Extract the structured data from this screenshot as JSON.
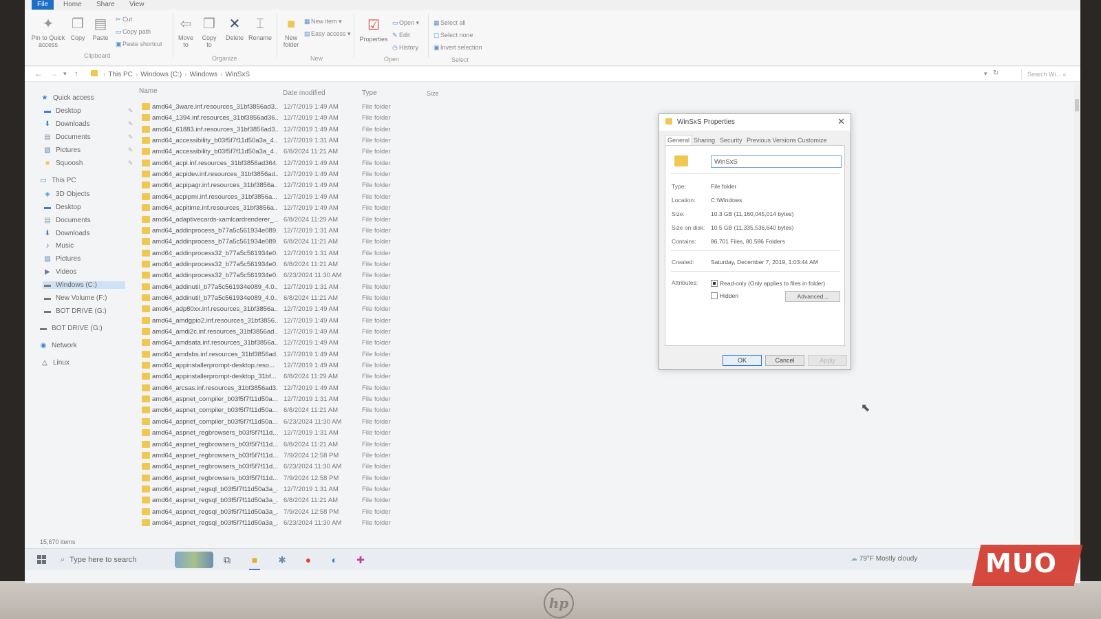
{
  "ribbon": {
    "tabs": [
      "File",
      "Home",
      "Share",
      "View"
    ],
    "clipboard": {
      "pin_label": "Pin to Quick access",
      "copy_label": "Copy",
      "paste_label": "Paste",
      "cut": "Cut",
      "copy_path": "Copy path",
      "paste_shortcut": "Paste shortcut",
      "group": "Clipboard"
    },
    "organize": {
      "move_to": "Move to",
      "copy_to": "Copy to",
      "delete": "Delete",
      "rename": "Rename",
      "group": "Organize"
    },
    "new": {
      "new_folder": "New folder",
      "new_item": "New item",
      "easy_access": "Easy access",
      "group": "New"
    },
    "open": {
      "properties": "Properties",
      "open": "Open",
      "edit": "Edit",
      "history": "History",
      "group": "Open"
    },
    "select": {
      "select_all": "Select all",
      "select_none": "Select none",
      "invert": "Invert selection",
      "group": "Select"
    }
  },
  "address": {
    "crumbs": [
      "This PC",
      "Windows (C:)",
      "Windows",
      "WinSxS"
    ],
    "search_placeholder": "Search Wi..."
  },
  "sidebar": {
    "items": [
      {
        "label": "Quick access",
        "icon": "star-icon",
        "pinned": false
      },
      {
        "label": "Desktop",
        "icon": "desktop-icon",
        "pinned": true
      },
      {
        "label": "Downloads",
        "icon": "download-icon",
        "pinned": true
      },
      {
        "label": "Documents",
        "icon": "document-icon",
        "pinned": true
      },
      {
        "label": "Pictures",
        "icon": "picture-icon",
        "pinned": true
      },
      {
        "label": "Squoosh",
        "icon": "folder-icon",
        "pinned": true
      },
      {
        "label": "This PC",
        "icon": "computer-icon",
        "pinned": false
      },
      {
        "label": "3D Objects",
        "icon": "cube-icon",
        "pinned": false
      },
      {
        "label": "Desktop",
        "icon": "desktop-icon",
        "pinned": false
      },
      {
        "label": "Documents",
        "icon": "document-icon",
        "pinned": false
      },
      {
        "label": "Downloads",
        "icon": "download-icon",
        "pinned": false
      },
      {
        "label": "Music",
        "icon": "music-icon",
        "pinned": false
      },
      {
        "label": "Pictures",
        "icon": "picture-icon",
        "pinned": false
      },
      {
        "label": "Videos",
        "icon": "video-icon",
        "pinned": false
      },
      {
        "label": "Windows (C:)",
        "icon": "drive-icon",
        "pinned": false
      },
      {
        "label": "New Volume (F:)",
        "icon": "drive-icon",
        "pinned": false
      },
      {
        "label": "BOT DRIVE (G:)",
        "icon": "drive-icon",
        "pinned": false
      },
      {
        "label": "BOT DRIVE (G:)",
        "icon": "drive-icon",
        "pinned": false
      },
      {
        "label": "Network",
        "icon": "network-icon",
        "pinned": false
      },
      {
        "label": "Linux",
        "icon": "linux-icon",
        "pinned": false
      }
    ]
  },
  "columns": {
    "name": "Name",
    "date": "Date modified",
    "type": "Type",
    "size": "Size"
  },
  "files": [
    {
      "name": "amd64_3ware.inf.resources_31bf3856ad3...",
      "date": "12/7/2019 1:49 AM",
      "type": "File folder"
    },
    {
      "name": "amd64_1394.inf.resources_31bf3856ad36...",
      "date": "12/7/2019 1:49 AM",
      "type": "File folder"
    },
    {
      "name": "amd64_61883.inf.resources_31bf3856ad3...",
      "date": "12/7/2019 1:49 AM",
      "type": "File folder"
    },
    {
      "name": "amd64_accessibility_b03f5f7f11d50a3a_4...",
      "date": "12/7/2019 1:31 AM",
      "type": "File folder"
    },
    {
      "name": "amd64_accessibility_b03f5f7f11d50a3a_4...",
      "date": "6/8/2024 11:21 AM",
      "type": "File folder"
    },
    {
      "name": "amd64_acpi.inf.resources_31bf3856ad364...",
      "date": "12/7/2019 1:49 AM",
      "type": "File folder"
    },
    {
      "name": "amd64_acpidev.inf.resources_31bf3856ad...",
      "date": "12/7/2019 1:49 AM",
      "type": "File folder"
    },
    {
      "name": "amd64_acpipagr.inf.resources_31bf3856a...",
      "date": "12/7/2019 1:49 AM",
      "type": "File folder"
    },
    {
      "name": "amd64_acpipmi.inf.resources_31bf3856a...",
      "date": "12/7/2019 1:49 AM",
      "type": "File folder"
    },
    {
      "name": "amd64_acpitime.inf.resources_31bf3856a...",
      "date": "12/7/2019 1:49 AM",
      "type": "File folder"
    },
    {
      "name": "amd64_adaptivecards-xamlcardrenderer_...",
      "date": "6/8/2024 11:29 AM",
      "type": "File folder"
    },
    {
      "name": "amd64_addinprocess_b77a5c561934e089...",
      "date": "12/7/2019 1:31 AM",
      "type": "File folder"
    },
    {
      "name": "amd64_addinprocess_b77a5c561934e089...",
      "date": "6/8/2024 11:21 AM",
      "type": "File folder"
    },
    {
      "name": "amd64_addinprocess32_b77a5c561934e0...",
      "date": "12/7/2019 1:31 AM",
      "type": "File folder"
    },
    {
      "name": "amd64_addinprocess32_b77a5c561934e0...",
      "date": "6/8/2024 11:21 AM",
      "type": "File folder"
    },
    {
      "name": "amd64_addinprocess32_b77a5c561934e0...",
      "date": "6/23/2024 11:30 AM",
      "type": "File folder"
    },
    {
      "name": "amd64_addinutil_b77a5c561934e089_4.0....",
      "date": "12/7/2019 1:31 AM",
      "type": "File folder"
    },
    {
      "name": "amd64_addinutil_b77a5c561934e089_4.0....",
      "date": "6/8/2024 11:21 AM",
      "type": "File folder"
    },
    {
      "name": "amd64_adp80xx.inf.resources_31bf3856a...",
      "date": "12/7/2019 1:49 AM",
      "type": "File folder"
    },
    {
      "name": "amd64_amdgpio2.inf.resources_31bf3856...",
      "date": "12/7/2019 1:49 AM",
      "type": "File folder"
    },
    {
      "name": "amd64_amdi2c.inf.resources_31bf3856ad...",
      "date": "12/7/2019 1:49 AM",
      "type": "File folder"
    },
    {
      "name": "amd64_amdsata.inf.resources_31bf3856a...",
      "date": "12/7/2019 1:49 AM",
      "type": "File folder"
    },
    {
      "name": "amd64_amdsbs.inf.resources_31bf3856ad...",
      "date": "12/7/2019 1:49 AM",
      "type": "File folder"
    },
    {
      "name": "amd64_appinstallerprompt-desktop.reso...",
      "date": "12/7/2019 1:49 AM",
      "type": "File folder"
    },
    {
      "name": "amd64_appinstallerprompt-desktop_31bf...",
      "date": "6/8/2024 11:29 AM",
      "type": "File folder"
    },
    {
      "name": "amd64_arcsas.inf.resources_31bf3856ad3...",
      "date": "12/7/2019 1:49 AM",
      "type": "File folder"
    },
    {
      "name": "amd64_aspnet_compiler_b03f5f7f11d50a...",
      "date": "12/7/2019 1:31 AM",
      "type": "File folder"
    },
    {
      "name": "amd64_aspnet_compiler_b03f5f7f11d50a...",
      "date": "6/8/2024 11:21 AM",
      "type": "File folder"
    },
    {
      "name": "amd64_aspnet_compiler_b03f5f7f11d50a...",
      "date": "6/23/2024 11:30 AM",
      "type": "File folder"
    },
    {
      "name": "amd64_aspnet_regbrowsers_b03f5f7f11d...",
      "date": "12/7/2019 1:31 AM",
      "type": "File folder"
    },
    {
      "name": "amd64_aspnet_regbrowsers_b03f5f7f11d...",
      "date": "6/8/2024 11:21 AM",
      "type": "File folder"
    },
    {
      "name": "amd64_aspnet_regbrowsers_b03f5f7f11d...",
      "date": "7/9/2024 12:58 PM",
      "type": "File folder"
    },
    {
      "name": "amd64_aspnet_regbrowsers_b03f5f7f11d...",
      "date": "6/23/2024 11:30 AM",
      "type": "File folder"
    },
    {
      "name": "amd64_aspnet_regbrowsers_b03f5f7f11d...",
      "date": "7/9/2024 12:58 PM",
      "type": "File folder"
    },
    {
      "name": "amd64_aspnet_regsql_b03f5f7f11d50a3a_...",
      "date": "12/7/2019 1:31 AM",
      "type": "File folder"
    },
    {
      "name": "amd64_aspnet_regsql_b03f5f7f11d50a3a_...",
      "date": "6/8/2024 11:21 AM",
      "type": "File folder"
    },
    {
      "name": "amd64_aspnet_regsql_b03f5f7f11d50a3a_...",
      "date": "7/9/2024 12:58 PM",
      "type": "File folder"
    },
    {
      "name": "amd64_aspnet_regsql_b03f5f7f11d50a3a_...",
      "date": "6/23/2024 11:30 AM",
      "type": "File folder"
    }
  ],
  "status": {
    "count": "15,670 items"
  },
  "dialog": {
    "title": "WinSxS Properties",
    "tabs": [
      "General",
      "Sharing",
      "Security",
      "Previous Versions",
      "Customize"
    ],
    "active_tab": "General",
    "name": "WinSxS",
    "labels": {
      "type": "Type:",
      "location": "Location:",
      "size": "Size:",
      "size_on_disk": "Size on disk:",
      "contains": "Contains:",
      "created": "Created:",
      "attributes": "Attributes:"
    },
    "values": {
      "type": "File folder",
      "location": "C:\\Windows",
      "size": "10.3 GB (11,160,045,014 bytes)",
      "size_on_disk": "10.5 GB (11,335,536,640 bytes)",
      "contains": "86,701 Files, 80,586 Folders",
      "created": "Saturday, December 7, 2019, 1:03:44 AM"
    },
    "readonly_label": "Read-only (Only applies to files in folder)",
    "hidden_label": "Hidden",
    "readonly_checked": true,
    "hidden_checked": false,
    "advanced": "Advanced...",
    "ok": "OK",
    "cancel": "Cancel",
    "apply": "Apply"
  },
  "taskbar": {
    "search_placeholder": "Type here to search",
    "weather": "79°F  Mostly cloudy"
  },
  "watermark": "MUO",
  "bezel_logo": "hp"
}
